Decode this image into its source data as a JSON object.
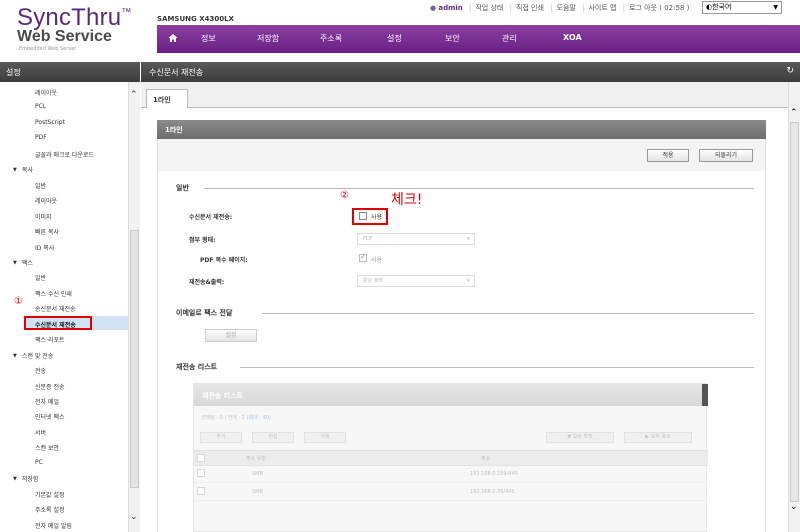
{
  "header": {
    "logo_main": "SyncThru",
    "logo_tm": "™",
    "logo_sub": "Web Service",
    "logo_tag": "Embedded Web Server",
    "model": "SAMSUNG X4300LX",
    "top_links": {
      "admin": "admin",
      "job_status": "작업 상태",
      "direct_print": "직접 인쇄",
      "help": "도움말",
      "sitemap": "사이트 맵",
      "logout": "로그 아웃 ( 02:58 )"
    },
    "language": "한국어",
    "nav": [
      "정보",
      "저장함",
      "주소록",
      "설정",
      "보안",
      "관리",
      "XOA"
    ]
  },
  "sidebar": {
    "title": "설정",
    "items": [
      {
        "label": "레이아웃",
        "group": false
      },
      {
        "label": "PCL",
        "group": false
      },
      {
        "label": "PostScript",
        "group": false
      },
      {
        "label": "PDF",
        "group": false
      },
      {
        "label": "글꼴과 매크로 다운로드",
        "group": false
      },
      {
        "label": "복사",
        "group": true
      },
      {
        "label": "일반",
        "group": false
      },
      {
        "label": "레이아웃",
        "group": false
      },
      {
        "label": "이미지",
        "group": false
      },
      {
        "label": "빠른 복사",
        "group": false
      },
      {
        "label": "ID 복사",
        "group": false
      },
      {
        "label": "팩스",
        "group": true
      },
      {
        "label": "일반",
        "group": false
      },
      {
        "label": "팩스 수신 인쇄",
        "group": false
      },
      {
        "label": "송신문서 재전송",
        "group": false
      },
      {
        "label": "수신문서 재전송",
        "group": false,
        "selected": true
      },
      {
        "label": "팩스 리포트",
        "group": false
      },
      {
        "label": "스캔 및 전송",
        "group": true
      },
      {
        "label": "전송",
        "group": false
      },
      {
        "label": "신분증 전송",
        "group": false
      },
      {
        "label": "전자 메일",
        "group": false
      },
      {
        "label": "인터넷 팩스",
        "group": false
      },
      {
        "label": "서버",
        "group": false
      },
      {
        "label": "스캔 보안",
        "group": false
      },
      {
        "label": "PC",
        "group": false
      },
      {
        "label": "저장함",
        "group": true
      },
      {
        "label": "기본값 설정",
        "group": false
      },
      {
        "label": "주소록 설정",
        "group": false
      },
      {
        "label": "전자 메일 알림",
        "group": false
      }
    ]
  },
  "main": {
    "title": "수신문서 재전송",
    "tab": "1라인",
    "section_bar": "1라인",
    "apply_button": "적용",
    "revert_button": "되돌리기",
    "general": {
      "title": "일반",
      "forward_label": "수신문서 재전송:",
      "forward_value": "사용",
      "attach_label": "첨부 형태:",
      "attach_value": "PDF",
      "pdf_multi_label": "PDF 복수 페이지:",
      "pdf_multi_value": "사용",
      "forward_print_label": "재전송&출력:",
      "forward_print_value": "항상 출력"
    },
    "email": {
      "title": "이메일로 팩스 전달",
      "settings_button": "설정"
    },
    "list": {
      "section_title": "재전송 리스트",
      "panel_title": "재전송 리스트",
      "count_text": "선택됨 : 0 | 전체 : 2 ",
      "count_max": "(최대 : 40)",
      "add_button": "추가",
      "edit_button": "편집",
      "delete_button": "삭제",
      "collapse_all": "▼ 모두 확장",
      "expand_all": "▶ 모두 축소",
      "columns": [
        "주소 유형",
        "주소"
      ],
      "rows": [
        {
          "type": "SMB",
          "address": "192.168.0.159/445"
        },
        {
          "type": "SMB",
          "address": "192.168.0.35/445"
        }
      ]
    }
  },
  "annotations": {
    "circle1": "①",
    "circle2": "②",
    "check_note": "체크!",
    "accent_color": "#e00000"
  }
}
